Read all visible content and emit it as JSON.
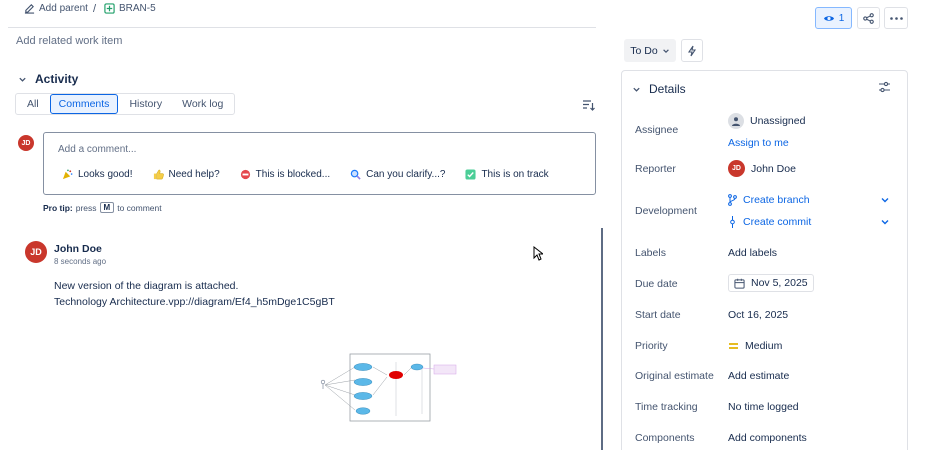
{
  "header": {
    "add_parent": "Add parent",
    "separator": "/",
    "issue_key": "BRAN-5",
    "add_related": "Add related work item"
  },
  "activity": {
    "title": "Activity",
    "tabs": [
      {
        "label": "All",
        "active": false
      },
      {
        "label": "Comments",
        "active": true
      },
      {
        "label": "History",
        "active": false
      },
      {
        "label": "Work log",
        "active": false
      }
    ]
  },
  "composer": {
    "avatar": "JD",
    "placeholder": "Add a comment...",
    "chips": [
      {
        "icon": "party-popper-icon",
        "label": "Looks good!"
      },
      {
        "icon": "thumbs-up-icon",
        "label": "Need help?"
      },
      {
        "icon": "no-entry-icon",
        "label": "This is blocked..."
      },
      {
        "icon": "magnifier-icon",
        "label": "Can you clarify...?"
      },
      {
        "icon": "check-box-icon",
        "label": "This is on track"
      }
    ],
    "pro_tip_prefix": "Pro tip:",
    "pro_tip_press": "press",
    "pro_tip_key": "M",
    "pro_tip_suffix": "to comment"
  },
  "comment": {
    "avatar": "JD",
    "author": "John Doe",
    "time": "8 seconds ago",
    "line1": "New version of the diagram is attached.",
    "line2": "Technology Architecture.vpp://diagram/Ef4_h5mDge1C5gBT"
  },
  "toolbar": {
    "watch_count": "1",
    "status": "To Do"
  },
  "details": {
    "title": "Details",
    "assignee_label": "Assignee",
    "assignee_value": "Unassigned",
    "assign_to_me": "Assign to me",
    "reporter_label": "Reporter",
    "reporter_avatar": "JD",
    "reporter_value": "John Doe",
    "development_label": "Development",
    "create_branch": "Create branch",
    "create_commit": "Create commit",
    "labels_label": "Labels",
    "labels_value": "Add labels",
    "due_label": "Due date",
    "due_value": "Nov 5, 2025",
    "start_label": "Start date",
    "start_value": "Oct 16, 2025",
    "priority_label": "Priority",
    "priority_value": "Medium",
    "estimate_label": "Original estimate",
    "estimate_value": "Add estimate",
    "tracking_label": "Time tracking",
    "tracking_value": "No time logged",
    "components_label": "Components",
    "components_value": "Add components"
  },
  "colors": {
    "accent": "#0c66e4",
    "avatar": "#c9372c",
    "priority_medium": "#e2b203"
  }
}
